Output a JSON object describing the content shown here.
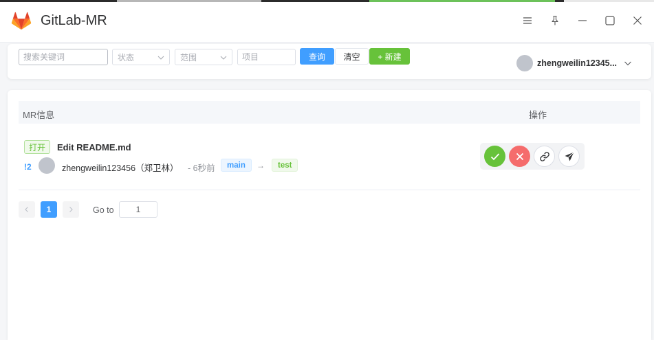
{
  "window": {
    "title": "GitLab-MR",
    "controls": [
      "menu-icon",
      "pin-icon",
      "minimize-icon",
      "maximize-icon",
      "close-icon"
    ]
  },
  "search": {
    "keyword_placeholder": "搜索关键词",
    "keyword_value": "",
    "status_placeholder": "状态",
    "scope_placeholder": "范围",
    "project_placeholder": "项目",
    "query_label": "查询",
    "clear_label": "清空",
    "new_label": "+ 新建"
  },
  "user": {
    "name": "zhengweilin12345..."
  },
  "table": {
    "headers": [
      "MR信息",
      "操作"
    ],
    "rows": [
      {
        "status": "打开",
        "title": "Edit README.md",
        "iid": "!2",
        "author": "zhengweilin123456（郑卫林）",
        "time": "- 6秒前",
        "source_branch": "main",
        "arrow": "→",
        "target_branch": "test",
        "actions": [
          "check-icon",
          "close-x-icon",
          "link-icon",
          "send-icon"
        ]
      }
    ]
  },
  "pagination": {
    "current": "1",
    "goto_label": "Go to",
    "goto_value": "1"
  },
  "colors": {
    "primary": "#409eff",
    "success": "#67c23a",
    "danger": "#f56c6c",
    "logo_orange": "#e24329",
    "logo_light": "#fca326"
  }
}
